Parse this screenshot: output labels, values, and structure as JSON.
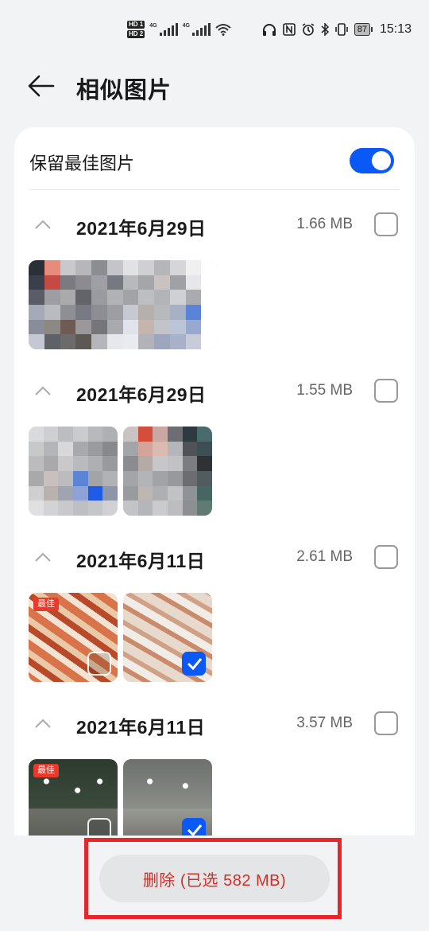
{
  "status_bar": {
    "sim1": "HD 1",
    "sim2": "HD 2",
    "net1": "4G",
    "net2": "4G",
    "battery": "87",
    "time": "15:13",
    "icons": [
      "headphones-icon",
      "nfc-icon",
      "alarm-icon",
      "bluetooth-icon",
      "vibrate-icon",
      "wifi-icon"
    ]
  },
  "header": {
    "title": "相似图片",
    "back_icon": "arrow-left-icon"
  },
  "keep_best": {
    "label": "保留最佳图片",
    "enabled": true
  },
  "groups": [
    {
      "date": "2021年6月29日",
      "size": "1.66 MB",
      "checked": false,
      "photos": [
        {
          "kind": "mosaic",
          "best": false,
          "selected": null
        }
      ]
    },
    {
      "date": "2021年6月29日",
      "size": "1.55 MB",
      "checked": false,
      "photos": [
        {
          "kind": "mosaic",
          "best": false,
          "selected": null
        },
        {
          "kind": "mosaic",
          "best": false,
          "selected": null
        }
      ]
    },
    {
      "date": "2021年6月11日",
      "size": "2.61 MB",
      "checked": false,
      "photos": [
        {
          "kind": "snack",
          "best": true,
          "selected": false
        },
        {
          "kind": "snack",
          "best": false,
          "selected": true
        }
      ]
    },
    {
      "date": "2021年6月11日",
      "size": "3.57 MB",
      "checked": false,
      "photos": [
        {
          "kind": "court",
          "best": true,
          "selected": false
        },
        {
          "kind": "court",
          "best": false,
          "selected": true
        }
      ]
    }
  ],
  "best_badge": "最佳",
  "delete_button": "删除 (已选 582 MB)",
  "colors": {
    "accent": "#0a59f7",
    "delete_text": "#d0302a",
    "highlight": "#e8252a",
    "best_badge": "#e8392a"
  }
}
